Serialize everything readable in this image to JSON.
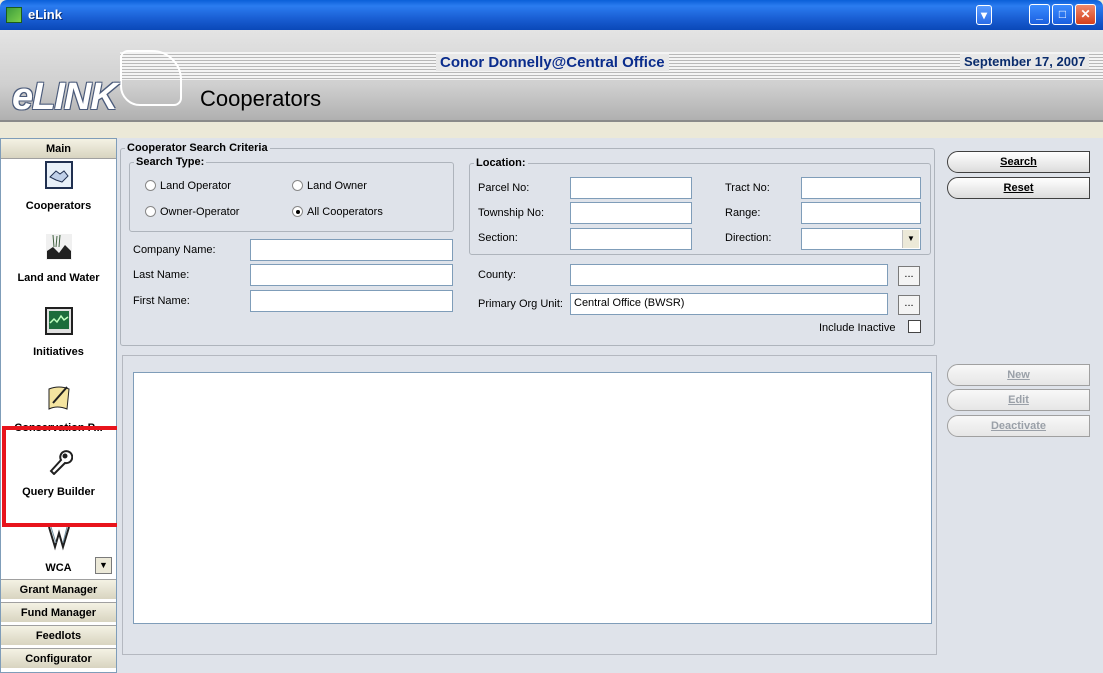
{
  "window": {
    "title": "eLink"
  },
  "header": {
    "logo": "eLINK",
    "user": "Conor Donnelly@Central Office",
    "date": "September 17, 2007",
    "page_title": "Cooperators"
  },
  "sidebar": {
    "head": "Main",
    "items": [
      {
        "label": "Cooperators",
        "icon": "handshake-icon"
      },
      {
        "label": "Land and Water",
        "icon": "landscape-icon"
      },
      {
        "label": "Initiatives",
        "icon": "monitor-chart-icon"
      },
      {
        "label": "Conservation P...",
        "icon": "document-pen-icon"
      },
      {
        "label": "Query Builder",
        "icon": "wrench-icon"
      },
      {
        "label": "WCA",
        "icon": "wetland-icon"
      }
    ],
    "footer": [
      "Grant Manager",
      "Fund Manager",
      "Feedlots",
      "Configurator"
    ]
  },
  "criteria": {
    "legend": "Cooperator Search Criteria",
    "search_type": {
      "legend": "Search Type:",
      "options": [
        "Land Operator",
        "Land Owner",
        "Owner-Operator",
        "All Cooperators"
      ],
      "selected": "All Cooperators"
    },
    "company_name": {
      "label": "Company Name:",
      "value": ""
    },
    "last_name": {
      "label": "Last Name:",
      "value": ""
    },
    "first_name": {
      "label": "First Name:",
      "value": ""
    },
    "location": {
      "legend": "Location:",
      "parcel_no": {
        "label": "Parcel No:",
        "value": ""
      },
      "tract_no": {
        "label": "Tract No:",
        "value": ""
      },
      "township_no": {
        "label": "Township No:",
        "value": ""
      },
      "range": {
        "label": "Range:",
        "value": ""
      },
      "section": {
        "label": "Section:",
        "value": ""
      },
      "direction": {
        "label": "Direction:",
        "value": ""
      }
    },
    "county": {
      "label": "County:",
      "value": ""
    },
    "primary_org": {
      "label": "Primary Org Unit:",
      "value": "Central Office (BWSR)"
    },
    "include_inactive": {
      "label": "Include Inactive",
      "checked": false
    }
  },
  "buttons": {
    "search": "Search",
    "reset": "Reset",
    "new": "New",
    "edit": "Edit",
    "deactivate": "Deactivate"
  }
}
